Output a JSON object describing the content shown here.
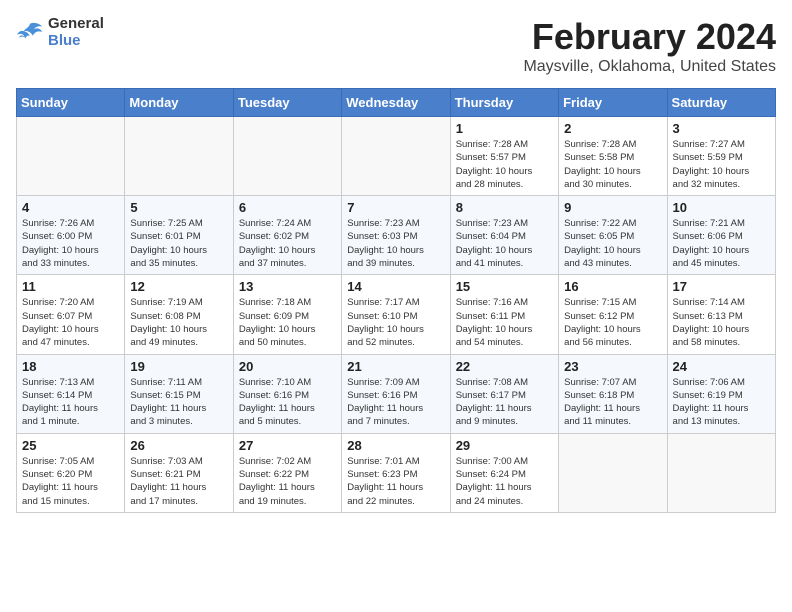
{
  "logo": {
    "text1": "General",
    "text2": "Blue"
  },
  "header": {
    "title": "February 2024",
    "subtitle": "Maysville, Oklahoma, United States"
  },
  "weekdays": [
    "Sunday",
    "Monday",
    "Tuesday",
    "Wednesday",
    "Thursday",
    "Friday",
    "Saturday"
  ],
  "weeks": [
    [
      {
        "day": "",
        "info": ""
      },
      {
        "day": "",
        "info": ""
      },
      {
        "day": "",
        "info": ""
      },
      {
        "day": "",
        "info": ""
      },
      {
        "day": "1",
        "info": "Sunrise: 7:28 AM\nSunset: 5:57 PM\nDaylight: 10 hours\nand 28 minutes."
      },
      {
        "day": "2",
        "info": "Sunrise: 7:28 AM\nSunset: 5:58 PM\nDaylight: 10 hours\nand 30 minutes."
      },
      {
        "day": "3",
        "info": "Sunrise: 7:27 AM\nSunset: 5:59 PM\nDaylight: 10 hours\nand 32 minutes."
      }
    ],
    [
      {
        "day": "4",
        "info": "Sunrise: 7:26 AM\nSunset: 6:00 PM\nDaylight: 10 hours\nand 33 minutes."
      },
      {
        "day": "5",
        "info": "Sunrise: 7:25 AM\nSunset: 6:01 PM\nDaylight: 10 hours\nand 35 minutes."
      },
      {
        "day": "6",
        "info": "Sunrise: 7:24 AM\nSunset: 6:02 PM\nDaylight: 10 hours\nand 37 minutes."
      },
      {
        "day": "7",
        "info": "Sunrise: 7:23 AM\nSunset: 6:03 PM\nDaylight: 10 hours\nand 39 minutes."
      },
      {
        "day": "8",
        "info": "Sunrise: 7:23 AM\nSunset: 6:04 PM\nDaylight: 10 hours\nand 41 minutes."
      },
      {
        "day": "9",
        "info": "Sunrise: 7:22 AM\nSunset: 6:05 PM\nDaylight: 10 hours\nand 43 minutes."
      },
      {
        "day": "10",
        "info": "Sunrise: 7:21 AM\nSunset: 6:06 PM\nDaylight: 10 hours\nand 45 minutes."
      }
    ],
    [
      {
        "day": "11",
        "info": "Sunrise: 7:20 AM\nSunset: 6:07 PM\nDaylight: 10 hours\nand 47 minutes."
      },
      {
        "day": "12",
        "info": "Sunrise: 7:19 AM\nSunset: 6:08 PM\nDaylight: 10 hours\nand 49 minutes."
      },
      {
        "day": "13",
        "info": "Sunrise: 7:18 AM\nSunset: 6:09 PM\nDaylight: 10 hours\nand 50 minutes."
      },
      {
        "day": "14",
        "info": "Sunrise: 7:17 AM\nSunset: 6:10 PM\nDaylight: 10 hours\nand 52 minutes."
      },
      {
        "day": "15",
        "info": "Sunrise: 7:16 AM\nSunset: 6:11 PM\nDaylight: 10 hours\nand 54 minutes."
      },
      {
        "day": "16",
        "info": "Sunrise: 7:15 AM\nSunset: 6:12 PM\nDaylight: 10 hours\nand 56 minutes."
      },
      {
        "day": "17",
        "info": "Sunrise: 7:14 AM\nSunset: 6:13 PM\nDaylight: 10 hours\nand 58 minutes."
      }
    ],
    [
      {
        "day": "18",
        "info": "Sunrise: 7:13 AM\nSunset: 6:14 PM\nDaylight: 11 hours\nand 1 minute."
      },
      {
        "day": "19",
        "info": "Sunrise: 7:11 AM\nSunset: 6:15 PM\nDaylight: 11 hours\nand 3 minutes."
      },
      {
        "day": "20",
        "info": "Sunrise: 7:10 AM\nSunset: 6:16 PM\nDaylight: 11 hours\nand 5 minutes."
      },
      {
        "day": "21",
        "info": "Sunrise: 7:09 AM\nSunset: 6:16 PM\nDaylight: 11 hours\nand 7 minutes."
      },
      {
        "day": "22",
        "info": "Sunrise: 7:08 AM\nSunset: 6:17 PM\nDaylight: 11 hours\nand 9 minutes."
      },
      {
        "day": "23",
        "info": "Sunrise: 7:07 AM\nSunset: 6:18 PM\nDaylight: 11 hours\nand 11 minutes."
      },
      {
        "day": "24",
        "info": "Sunrise: 7:06 AM\nSunset: 6:19 PM\nDaylight: 11 hours\nand 13 minutes."
      }
    ],
    [
      {
        "day": "25",
        "info": "Sunrise: 7:05 AM\nSunset: 6:20 PM\nDaylight: 11 hours\nand 15 minutes."
      },
      {
        "day": "26",
        "info": "Sunrise: 7:03 AM\nSunset: 6:21 PM\nDaylight: 11 hours\nand 17 minutes."
      },
      {
        "day": "27",
        "info": "Sunrise: 7:02 AM\nSunset: 6:22 PM\nDaylight: 11 hours\nand 19 minutes."
      },
      {
        "day": "28",
        "info": "Sunrise: 7:01 AM\nSunset: 6:23 PM\nDaylight: 11 hours\nand 22 minutes."
      },
      {
        "day": "29",
        "info": "Sunrise: 7:00 AM\nSunset: 6:24 PM\nDaylight: 11 hours\nand 24 minutes."
      },
      {
        "day": "",
        "info": ""
      },
      {
        "day": "",
        "info": ""
      }
    ]
  ]
}
